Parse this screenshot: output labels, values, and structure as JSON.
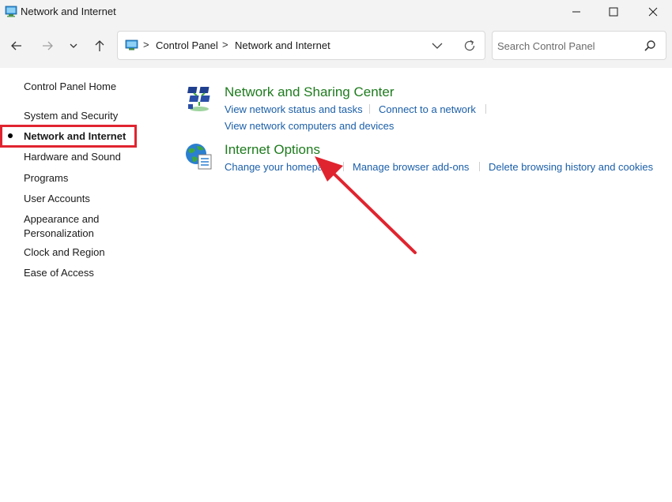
{
  "window": {
    "title": "Network and Internet"
  },
  "navigation": {
    "breadcrumbs": [
      "Control Panel",
      "Network and Internet"
    ],
    "breadcrumb_separator": ">",
    "search_placeholder": "Search Control Panel"
  },
  "sidebar": {
    "home": "Control Panel Home",
    "items": [
      {
        "label": "System and Security",
        "active": false
      },
      {
        "label": "Network and Internet",
        "active": true
      },
      {
        "label": "Hardware and Sound",
        "active": false
      },
      {
        "label": "Programs",
        "active": false
      },
      {
        "label": "User Accounts",
        "active": false
      },
      {
        "label": "Appearance and",
        "label2": "Personalization",
        "active": false
      },
      {
        "label": "Clock and Region",
        "active": false
      },
      {
        "label": "Ease of Access",
        "active": false
      }
    ]
  },
  "categories": [
    {
      "title": "Network and Sharing Center",
      "icon": "network-sharing-center-icon",
      "links": [
        "View network status and tasks",
        "Connect to a network",
        "View network computers and devices"
      ]
    },
    {
      "title": "Internet Options",
      "icon": "internet-options-globe-icon",
      "links": [
        "Change your homepage",
        "Manage browser add-ons",
        "Delete browsing history and cookies"
      ]
    }
  ],
  "colors": {
    "category_title": "#1e7b1e",
    "link": "#1b5fa8",
    "annotation": "#e0242f"
  }
}
